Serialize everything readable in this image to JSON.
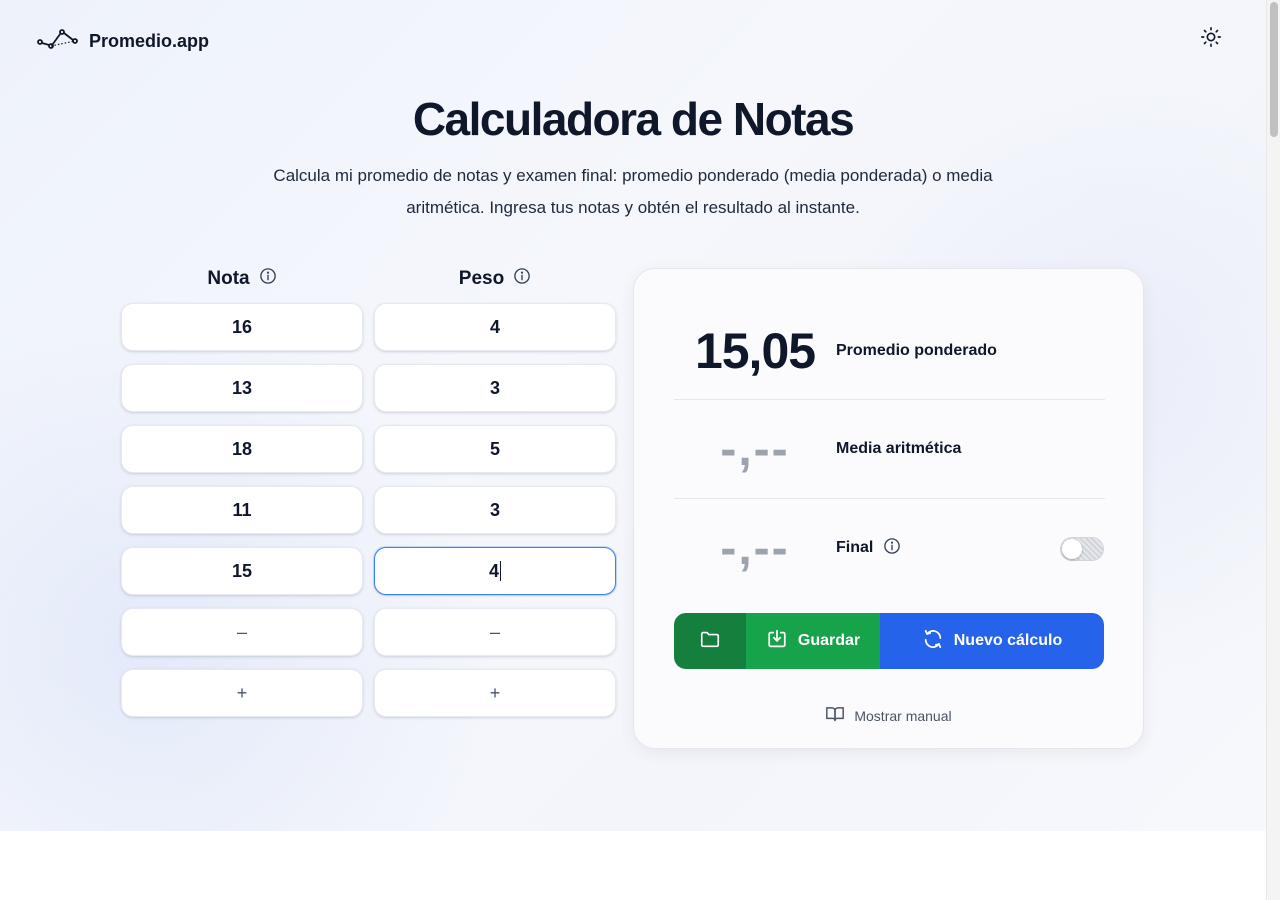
{
  "brand": {
    "name": "Promedio.app",
    "logo_icon": "chart-line-icon"
  },
  "header": {
    "theme_icon": "sun-icon"
  },
  "hero": {
    "title": "Calculadora de Notas",
    "subtitle": "Calcula mi promedio de notas y examen final: promedio ponderado (media ponderada) o media aritmética. Ingresa tus notas y obtén el resultado al instante."
  },
  "columns": {
    "nota_label": "Nota",
    "peso_label": "Peso"
  },
  "rows": [
    {
      "nota": "16",
      "peso": "4"
    },
    {
      "nota": "13",
      "peso": "3"
    },
    {
      "nota": "18",
      "peso": "5"
    },
    {
      "nota": "11",
      "peso": "3"
    },
    {
      "nota": "15",
      "peso": "4"
    }
  ],
  "controls": {
    "remove": "–",
    "add": "+"
  },
  "results": {
    "weighted": {
      "value": "15,05",
      "label": "Promedio ponderado"
    },
    "arithmetic": {
      "value": "-,--",
      "label": "Media aritmética"
    },
    "final": {
      "value": "-,--",
      "label": "Final",
      "enabled": false
    }
  },
  "actions": {
    "save": "Guardar",
    "new_calc": "Nuevo cálculo",
    "manual": "Mostrar manual"
  }
}
